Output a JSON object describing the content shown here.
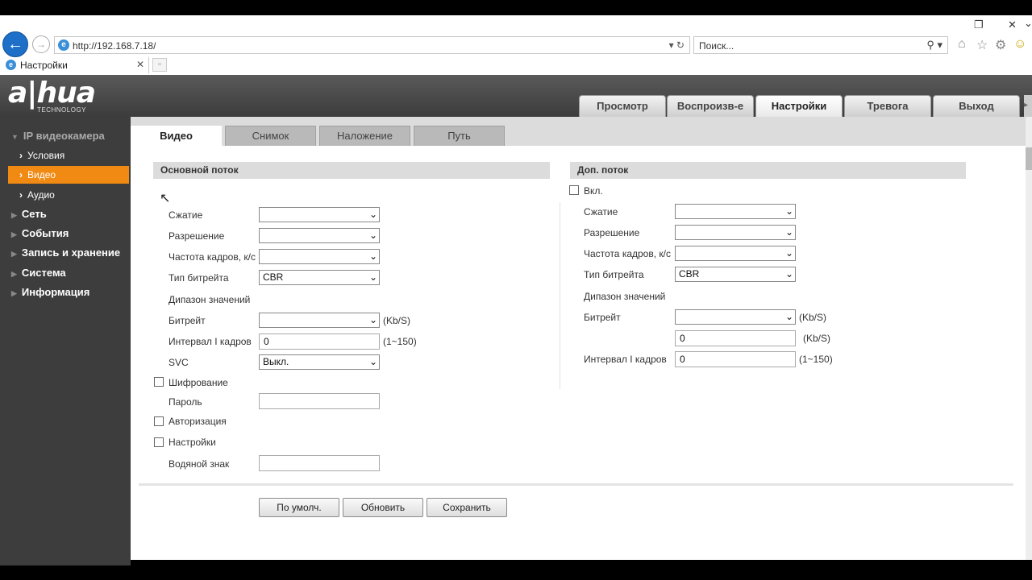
{
  "browser": {
    "url": "http://192.168.7.18/",
    "search_placeholder": "Поиск...",
    "tab_title": "Настройки",
    "win_restore": "❐",
    "win_close": "✕",
    "win_chevron": "⌄"
  },
  "logo": {
    "brand": "a|hua",
    "sub": "TECHNOLOGY"
  },
  "topnav": [
    "Просмотр",
    "Воспроизв-е",
    "Настройки",
    "Тревога",
    "Выход"
  ],
  "sidebar": {
    "header": "IP видеокамера",
    "subs": [
      "Условия",
      "Видео",
      "Аудио"
    ],
    "sections": [
      "Сеть",
      "События",
      "Запись и хранение",
      "Система",
      "Информация"
    ]
  },
  "tabs": [
    "Видео",
    "Снимок",
    "Наложение",
    "Путь"
  ],
  "main_stream": {
    "title": "Основной поток",
    "labels": {
      "compression": "Сжатие",
      "resolution": "Разрешение",
      "framerate": "Частота кадров, к/с",
      "bitrate_type": "Тип битрейта",
      "range": "Дипазон значений",
      "bitrate": "Битрейт",
      "iframe": "Интервал I кадров",
      "svc": "SVC",
      "encryption": "Шифрование",
      "password": "Пароль",
      "auth": "Авторизация",
      "settings": "Настройки",
      "watermark": "Водяной знак"
    },
    "values": {
      "bitrate_type": "CBR",
      "iframe": "0",
      "svc": "Выкл."
    },
    "units": {
      "bitrate": "(Kb/S)",
      "iframe": "(1~150)"
    }
  },
  "sub_stream": {
    "title": "Доп. поток",
    "labels": {
      "enable": "Вкл.",
      "compression": "Сжатие",
      "resolution": "Разрешение",
      "framerate": "Частота кадров, к/с",
      "bitrate_type": "Тип битрейта",
      "range": "Дипазон значений",
      "bitrate": "Битрейт",
      "iframe": "Интервал I кадров"
    },
    "values": {
      "bitrate_type": "CBR",
      "bitrate_input": "0",
      "iframe": "0"
    },
    "units": {
      "bitrate": "(Kb/S)",
      "bitrate_input": "(Kb/S)",
      "iframe": "(1~150)"
    }
  },
  "buttons": {
    "default": "По умолч.",
    "refresh": "Обновить",
    "save": "Сохранить"
  }
}
